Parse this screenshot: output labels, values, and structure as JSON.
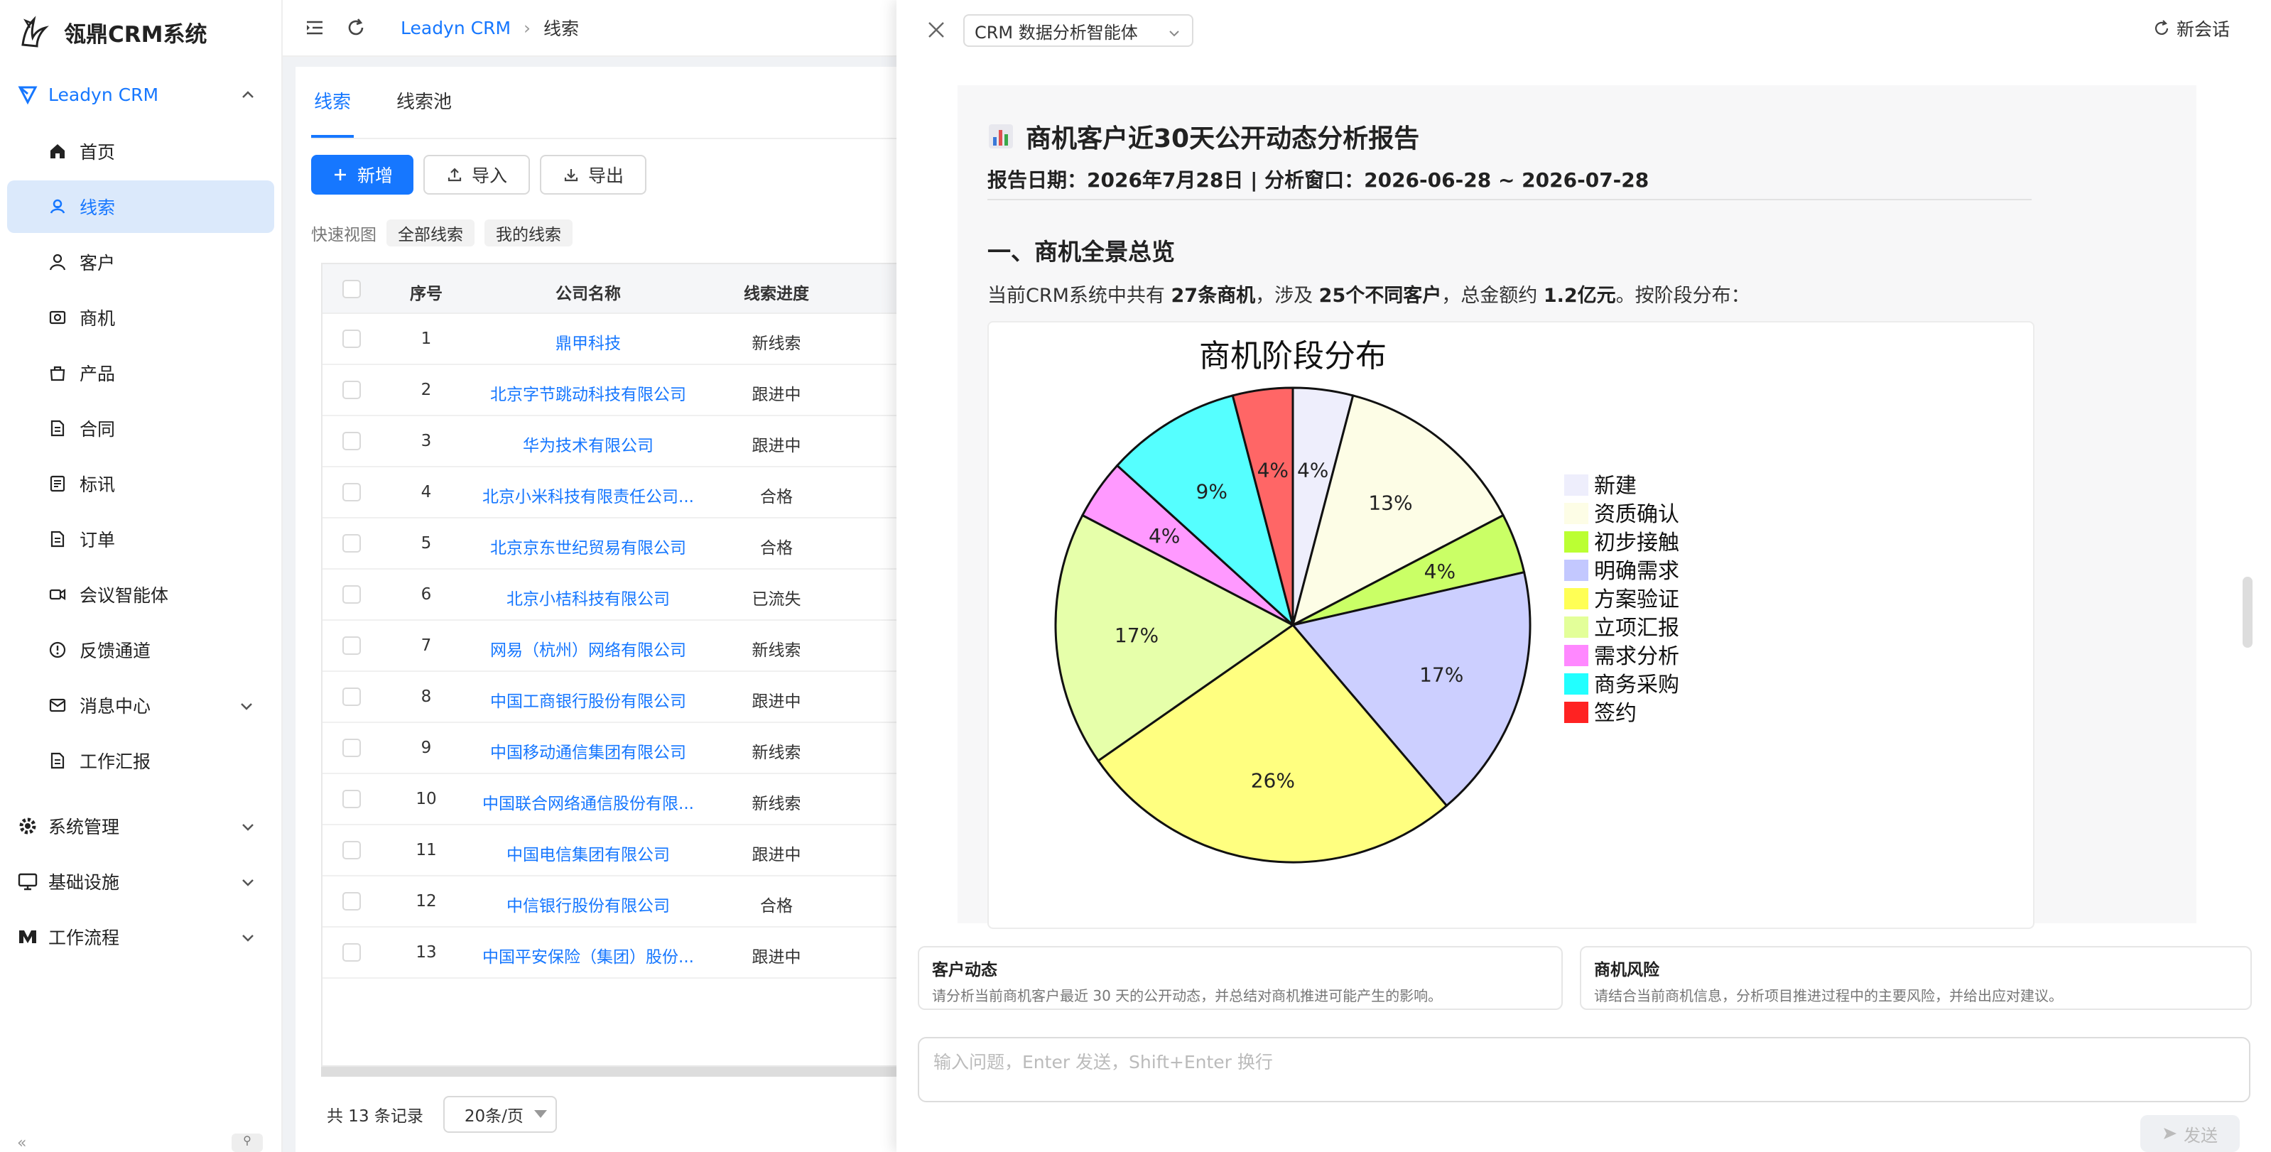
{
  "app": {
    "title": "瓴鼎CRM系统"
  },
  "sidebar": {
    "group_crm": "Leadyn CRM",
    "items": [
      {
        "label": "首页",
        "icon": "home-icon"
      },
      {
        "label": "线索",
        "icon": "leads-icon"
      },
      {
        "label": "客户",
        "icon": "user-icon"
      },
      {
        "label": "商机",
        "icon": "opportunity-icon"
      },
      {
        "label": "产品",
        "icon": "product-icon"
      },
      {
        "label": "合同",
        "icon": "contract-icon"
      },
      {
        "label": "标讯",
        "icon": "bid-icon"
      },
      {
        "label": "订单",
        "icon": "order-icon"
      },
      {
        "label": "会议智能体",
        "icon": "meeting-icon"
      },
      {
        "label": "反馈通道",
        "icon": "feedback-icon"
      },
      {
        "label": "消息中心",
        "icon": "mail-icon"
      },
      {
        "label": "工作汇报",
        "icon": "report-icon"
      }
    ],
    "groups": [
      {
        "label": "系统管理",
        "icon": "gear-icon"
      },
      {
        "label": "基础设施",
        "icon": "monitor-icon"
      },
      {
        "label": "工作流程",
        "icon": "workflow-icon"
      }
    ],
    "collapse": "«",
    "pin": "⚲"
  },
  "topbar": {
    "crumb_root": "Leadyn CRM",
    "crumb_sep": "›",
    "crumb_current": "线索"
  },
  "main": {
    "tabs": [
      "线索",
      "线索池"
    ],
    "buttons": {
      "add": "新增",
      "import": "导入",
      "export": "导出"
    },
    "quick_view_label": "快速视图",
    "quick_views": [
      "全部线索",
      "我的线索"
    ],
    "table": {
      "headers": [
        "序号",
        "公司名称",
        "线索进度"
      ],
      "rows": [
        {
          "no": "1",
          "company": "鼎甲科技",
          "status": "新线索"
        },
        {
          "no": "2",
          "company": "北京字节跳动科技有限公司",
          "status": "跟进中"
        },
        {
          "no": "3",
          "company": "华为技术有限公司",
          "status": "跟进中"
        },
        {
          "no": "4",
          "company": "北京小米科技有限责任公司...",
          "status": "合格"
        },
        {
          "no": "5",
          "company": "北京京东世纪贸易有限公司",
          "status": "合格"
        },
        {
          "no": "6",
          "company": "北京小桔科技有限公司",
          "status": "已流失"
        },
        {
          "no": "7",
          "company": "网易（杭州）网络有限公司",
          "status": "新线索"
        },
        {
          "no": "8",
          "company": "中国工商银行股份有限公司",
          "status": "跟进中"
        },
        {
          "no": "9",
          "company": "中国移动通信集团有限公司",
          "status": "新线索"
        },
        {
          "no": "10",
          "company": "中国联合网络通信股份有限...",
          "status": "新线索"
        },
        {
          "no": "11",
          "company": "中国电信集团有限公司",
          "status": "跟进中"
        },
        {
          "no": "12",
          "company": "中信银行股份有限公司",
          "status": "合格"
        },
        {
          "no": "13",
          "company": "中国平安保险（集团）股份...",
          "status": "跟进中"
        }
      ]
    },
    "pager": {
      "total": "共 13 条记录",
      "page_size": "20条/页"
    }
  },
  "drawer": {
    "agent": "CRM 数据分析智能体",
    "new_chat": "新会话",
    "report": {
      "title": "商机客户近30天公开动态分析报告",
      "date_line": "报告日期：2026年7月28日 | 分析窗口：2026-06-28 ~ 2026-07-28",
      "section1": "一、商机全景总览",
      "summary_pre": "当前CRM系统中共有 ",
      "summary_b1": "27条商机",
      "summary_mid1": "，涉及 ",
      "summary_b2": "25个不同客户",
      "summary_mid2": "，总金额约 ",
      "summary_b3": "1.2亿元",
      "summary_post": "。按阶段分布："
    },
    "suggestions": [
      {
        "title": "客户动态",
        "desc": "请分析当前商机客户最近 30 天的公开动态，并总结对商机推进可能产生的影响。"
      },
      {
        "title": "商机风险",
        "desc": "请结合当前商机信息，分析项目推进过程中的主要风险，并给出应对建议。"
      }
    ],
    "input_placeholder": "输入问题，Enter 发送，Shift+Enter 换行",
    "send": "发送"
  },
  "chart_data": {
    "type": "pie",
    "title": "商机阶段分布",
    "series": [
      {
        "name": "新建",
        "value": 4,
        "label": "4%",
        "color": "#eeeefc"
      },
      {
        "name": "资质确认",
        "value": 13,
        "label": "13%",
        "color": "#fdfde6"
      },
      {
        "name": "初步接触",
        "value": 4,
        "label": "4%",
        "color": "#caff66"
      },
      {
        "name": "明确需求",
        "value": 17,
        "label": "17%",
        "color": "#cccfff"
      },
      {
        "name": "方案验证",
        "value": 26,
        "label": "26%",
        "color": "#ffff80"
      },
      {
        "name": "立项汇报",
        "value": 17,
        "label": "17%",
        "color": "#e6ffaa"
      },
      {
        "name": "需求分析",
        "value": 4,
        "label": "4%",
        "color": "#ff99ff"
      },
      {
        "name": "商务采购",
        "value": 9,
        "label": "9%",
        "color": "#55ffff"
      },
      {
        "name": "签约",
        "value": 4,
        "label": "4%",
        "color": "#ff6666"
      }
    ],
    "legend_swatch_colors": [
      "#eeeefc",
      "#fdfde6",
      "#bbff33",
      "#c3c8ff",
      "#ffff55",
      "#e3ff99",
      "#ff88ff",
      "#22ffff",
      "#ff2222"
    ],
    "legend": "right"
  },
  "colors": {
    "accent": "#1677ff",
    "active_bg": "#dbe9fb"
  }
}
